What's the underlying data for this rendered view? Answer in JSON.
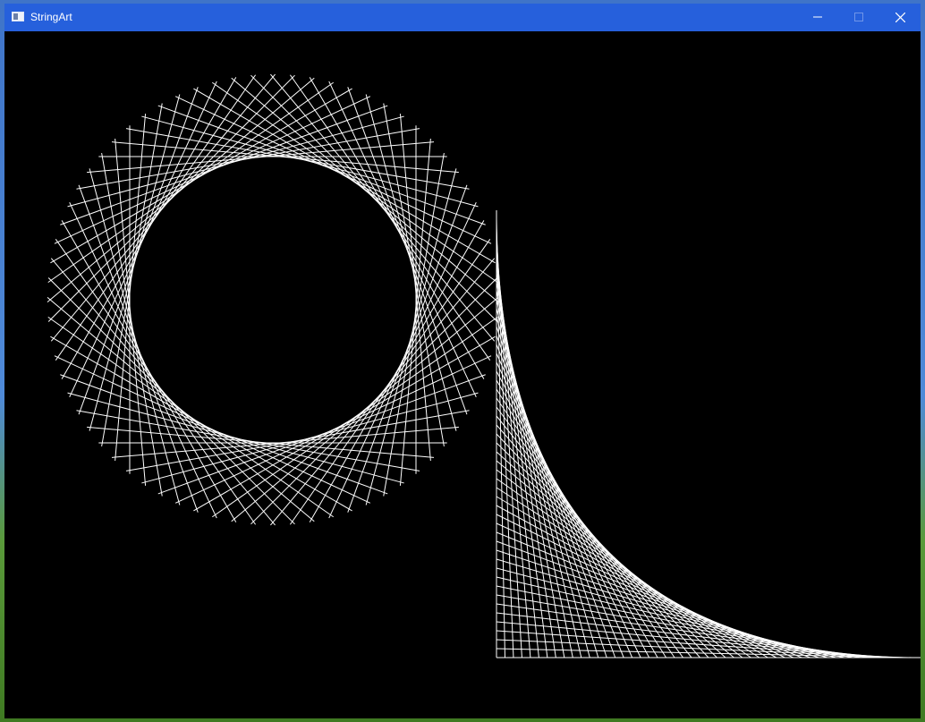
{
  "window": {
    "title": "StringArt",
    "controls": [
      {
        "name": "minimize",
        "icon": "minimize-icon"
      },
      {
        "name": "maximize",
        "icon": "maximize-icon",
        "enabled": false
      },
      {
        "name": "close",
        "icon": "close-icon"
      }
    ]
  },
  "colors": {
    "titlebar": "#2660dc",
    "canvas": "#000000",
    "strings": "#ffffff"
  },
  "artwork": [
    {
      "kind": "circle-string-art",
      "stroke": "#ffffff"
    },
    {
      "kind": "corner-string-art",
      "stroke": "#ffffff"
    }
  ]
}
